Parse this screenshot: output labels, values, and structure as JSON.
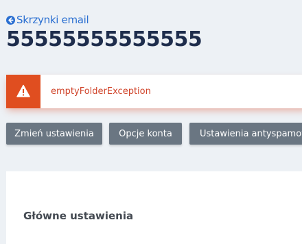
{
  "back_link": {
    "label": "Skrzynki email",
    "icon": "arrow-left-circle-icon"
  },
  "page": {
    "title": "55555555555555"
  },
  "alert": {
    "message": "emptyFolderException",
    "icon": "warning-icon",
    "color": "#e04e20"
  },
  "toolbar": {
    "buttons": [
      {
        "label": "Zmień ustawienia"
      },
      {
        "label": "Opcje konta"
      },
      {
        "label": "Ustawienia antyspamowe"
      }
    ]
  },
  "card": {
    "title": "Główne ustawienia"
  },
  "colors": {
    "background": "#edf1f5",
    "link": "#2a6fd1",
    "title": "#1e2d4c",
    "button": "#6a7682",
    "alert_text": "#d0442a"
  }
}
